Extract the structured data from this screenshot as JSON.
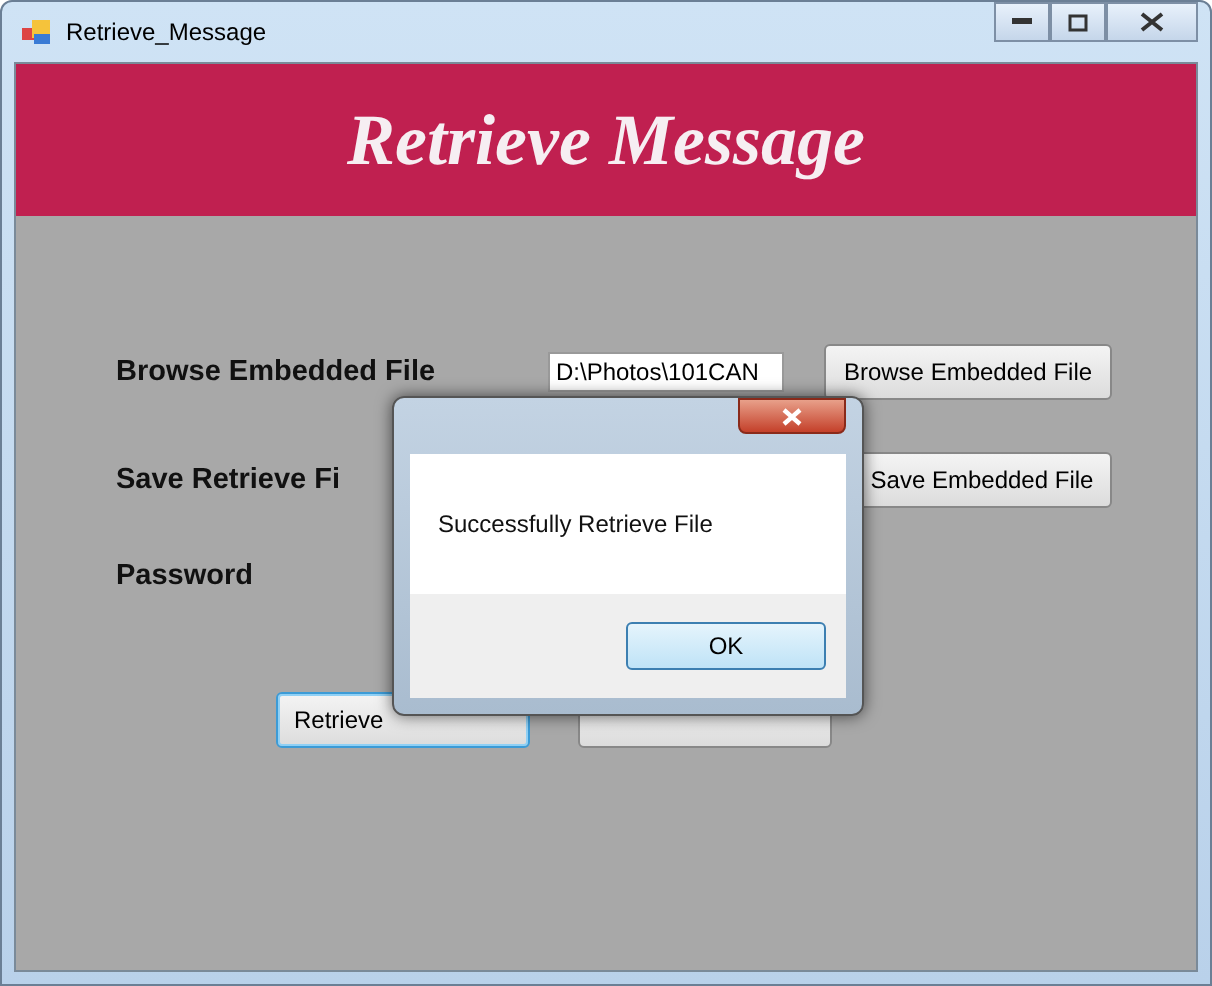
{
  "window": {
    "title": "Retrieve_Message"
  },
  "banner": {
    "title": "Retrieve Message"
  },
  "form": {
    "rows": [
      {
        "label": "Browse Embedded File",
        "value": "D:\\Photos\\101CAN",
        "button": "Browse Embedded File"
      },
      {
        "label": "Save Retrieve Fi",
        "button": "Save Embedded File"
      },
      {
        "label": "Password"
      }
    ],
    "actions": [
      {
        "label": "Retrieve",
        "focused": true
      },
      {
        "focused": false
      }
    ]
  },
  "dialog": {
    "message": "Successfully Retrieve File",
    "button": "OK"
  }
}
